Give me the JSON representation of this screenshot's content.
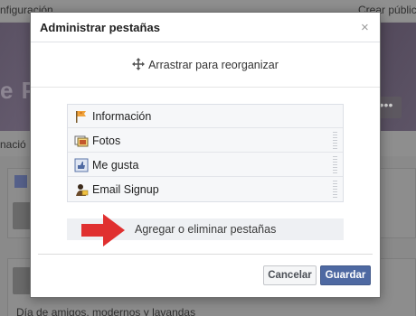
{
  "background": {
    "topbar_left": "nfiguración",
    "topbar_right": "Crear públic",
    "cover_text": "e Pi",
    "cover_button": "•••",
    "strip_text": "nació",
    "bottom_text": "Día de amigos, modernos y lavandas"
  },
  "dialog": {
    "title": "Administrar pestañas",
    "close_label": "×",
    "drag_hint": "Arrastrar para reorganizar",
    "tabs": [
      {
        "label": "Información",
        "icon": "info-flag-icon"
      },
      {
        "label": "Fotos",
        "icon": "photos-icon"
      },
      {
        "label": "Me gusta",
        "icon": "likes-icon"
      },
      {
        "label": "Email Signup",
        "icon": "email-signup-icon"
      }
    ],
    "add_remove_label": "Agregar o eliminar pestañas",
    "cancel_label": "Cancelar",
    "save_label": "Guardar"
  },
  "colors": {
    "accent": "#4e69a2",
    "arrow": "#e03030"
  }
}
